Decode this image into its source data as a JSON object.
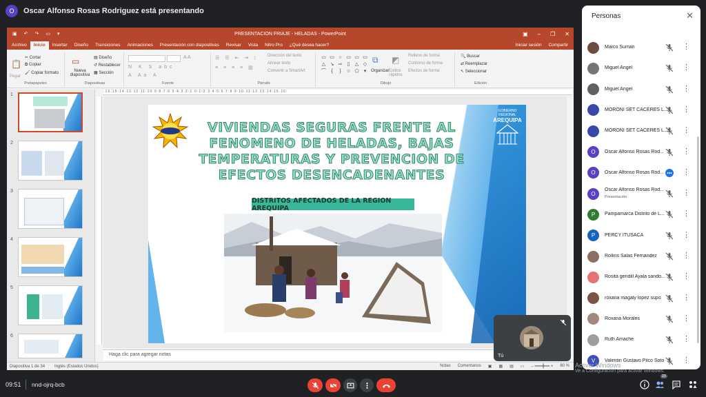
{
  "presenter": {
    "avatar_letter": "O",
    "text": "Oscar Alfonso Rosas Rodriguez está presentando"
  },
  "ppt": {
    "window_title": "PRESENTACION FRIAJE - HELADAS - PowerPoint",
    "tabs": [
      "Archivo",
      "Inicio",
      "Insertar",
      "Diseño",
      "Transiciones",
      "Animaciones",
      "Presentación con diapositivas",
      "Revisar",
      "Vista",
      "Nitro Pro",
      "¿Qué desea hacer?"
    ],
    "active_tab": "Inicio",
    "sign_in": "Iniciar sesión",
    "share": "Compartir",
    "ribbon": {
      "paste": "Pegar",
      "cut": "Cortar",
      "copy": "Copiar",
      "format_painter": "Copiar formato",
      "clipboard_group": "Portapapeles",
      "new_slide": "Nueva diapositiva",
      "layout": "Diseño",
      "reset": "Restablecer",
      "section": "Sección",
      "slides_group": "Diapositivas",
      "font_group": "Fuente",
      "text_direction": "Dirección del texto",
      "align_text": "Alinear texto",
      "smartart": "Convertir a SmartArt",
      "paragraph_group": "Párrafo",
      "arrange": "Organizar",
      "quick_styles": "Estilos rápidos",
      "shape_fill": "Relleno de forma",
      "shape_outline": "Contorno de forma",
      "shape_effects": "Efectos de forma",
      "drawing_group": "Dibujo",
      "find": "Buscar",
      "replace": "Reemplazar",
      "select": "Seleccionar",
      "editing_group": "Edición"
    },
    "thumb_numbers": [
      "1",
      "2",
      "3",
      "4",
      "5",
      "6"
    ],
    "slide": {
      "title": "VIVIENDAS SEGURAS FRENTE AL FENOMENO DE HELADAS, BAJAS TEMPERATURAS Y PREVENCION DE EFECTOS DESENCADENANTES",
      "subtitle": "DISTRITOS AFECTADOS DE LA REGION AREQUIPA",
      "logo_small": "GOBIERNO REGIONAL",
      "logo_big": "AREQUIPA"
    },
    "notes_placeholder": "Haga clic para agregar notas",
    "status_slide": "Diapositiva 1 de 34",
    "status_lang": "Inglés (Estados Unidos)",
    "status_notes": "Notas",
    "status_comments": "Comentarios",
    "status_zoom": "80 %"
  },
  "panel": {
    "title": "Personas",
    "people": [
      {
        "name": "Marco Sumari",
        "letter": "",
        "color": "#6d4c41",
        "sub": ""
      },
      {
        "name": "Miguel Angel",
        "letter": "",
        "color": "#757575",
        "sub": ""
      },
      {
        "name": "Miguel Angel",
        "letter": "",
        "color": "#616161",
        "sub": ""
      },
      {
        "name": "MORONI SET CACERES L...",
        "letter": "",
        "color": "#3949ab",
        "sub": ""
      },
      {
        "name": "MORONI SET CACERES L...",
        "letter": "",
        "color": "#3949ab",
        "sub": ""
      },
      {
        "name": "Oscar Alfonso Rosas Rod...",
        "letter": "O",
        "color": "#5b3fc4",
        "sub": ""
      },
      {
        "name": "Oscar Alfonso Rosas Rod...",
        "letter": "O",
        "color": "#5b3fc4",
        "sub": ""
      },
      {
        "name": "Oscar Alfonso Rosas Rod...",
        "letter": "O",
        "color": "#5b3fc4",
        "sub": "Presentación"
      },
      {
        "name": "Pampamarca Distrito de L...",
        "letter": "P",
        "color": "#2e7d32",
        "sub": ""
      },
      {
        "name": "PERCY ITUSACA",
        "letter": "P",
        "color": "#1565c0",
        "sub": ""
      },
      {
        "name": "Rollins Salas Fernandez",
        "letter": "",
        "color": "#8d6e63",
        "sub": ""
      },
      {
        "name": "Rosita gendill Ayala sando...",
        "letter": "",
        "color": "#e57373",
        "sub": ""
      },
      {
        "name": "roxana magaly lopez supo",
        "letter": "",
        "color": "#795548",
        "sub": ""
      },
      {
        "name": "Roxana Morales",
        "letter": "",
        "color": "#a1887f",
        "sub": ""
      },
      {
        "name": "Ruth Amache",
        "letter": "",
        "color": "#9e9e9e",
        "sub": ""
      },
      {
        "name": "Valentin Gustavo Pilco Soto",
        "letter": "V",
        "color": "#3f51b5",
        "sub": ""
      }
    ]
  },
  "self_view": {
    "label": "Tú"
  },
  "watermark": {
    "line1": "Activar Windows",
    "line2": "Ve a Configuración para activar Windows."
  },
  "bottom": {
    "time": "09:51",
    "meeting_code": "nnd-ojrq-bcb",
    "people_count": "23"
  },
  "colors": {
    "ppt_accent": "#b7472a",
    "hangup": "#ea4335",
    "meet_bg": "#202124"
  }
}
